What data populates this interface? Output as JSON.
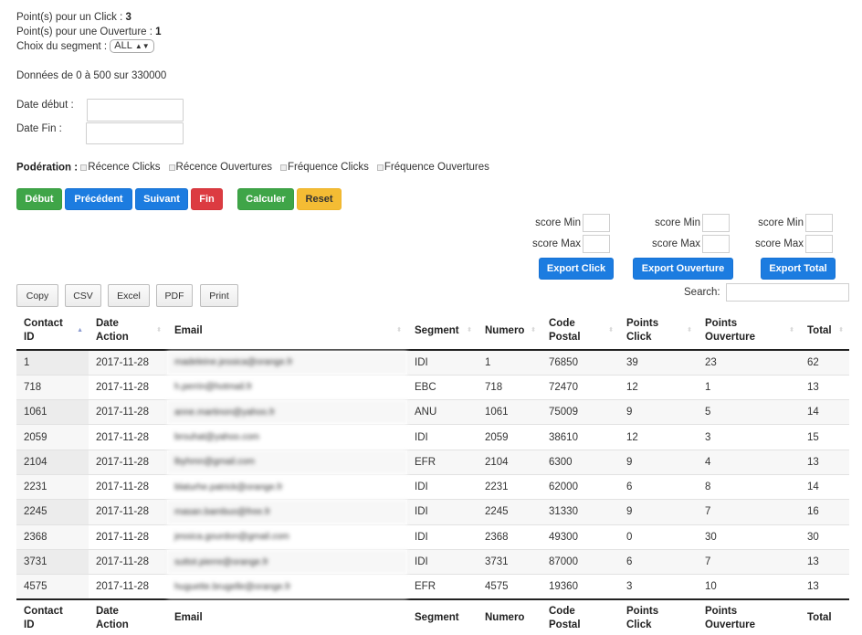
{
  "info": {
    "click_points_label": "Point(s) pour un Click : ",
    "click_points_value": "3",
    "open_points_label": "Point(s) pour une Ouverture : ",
    "open_points_value": "1",
    "segment_label": "Choix du segment : ",
    "segment_selected": "ALL",
    "data_range": "Données de 0 à 500 sur 330000"
  },
  "dates": {
    "start_label": "Date début :",
    "start_value": "",
    "end_label": "Date Fin :",
    "end_value": ""
  },
  "ponderation": {
    "label": "Podération : ",
    "options": [
      {
        "label": "Récence Clicks",
        "checked": false
      },
      {
        "label": "Récence Ouvertures",
        "checked": false
      },
      {
        "label": "Fréquence Clicks",
        "checked": false
      },
      {
        "label": "Fréquence Ouvertures",
        "checked": false
      }
    ]
  },
  "nav_buttons": {
    "debut": "Début",
    "precedent": "Précédent",
    "suivant": "Suivant",
    "fin": "Fin",
    "calculer": "Calculer",
    "reset": "Reset"
  },
  "colors": {
    "green": "#3fa548",
    "blue": "#1c7ce0",
    "red": "#dc3b41",
    "yellow": "#f4bc34"
  },
  "exports": [
    {
      "min_label": "score Min",
      "max_label": "score Max",
      "min_value": "",
      "max_value": "",
      "button": "Export Click"
    },
    {
      "min_label": "score Min",
      "max_label": "score Max",
      "min_value": "",
      "max_value": "",
      "button": "Export Ouverture"
    },
    {
      "min_label": "score Min",
      "max_label": "score Max",
      "min_value": "",
      "max_value": "",
      "button": "Export Total"
    }
  ],
  "table_buttons": [
    "Copy",
    "CSV",
    "Excel",
    "PDF",
    "Print"
  ],
  "search": {
    "label": "Search:",
    "value": ""
  },
  "table": {
    "columns": [
      {
        "line1": "Contact",
        "line2": "ID",
        "sort": "asc"
      },
      {
        "line1": "Date",
        "line2": "Action",
        "sort": "none"
      },
      {
        "line1": "Email",
        "line2": "",
        "sort": "none"
      },
      {
        "line1": "Segment",
        "line2": "",
        "sort": "none"
      },
      {
        "line1": "Numero",
        "line2": "",
        "sort": "none"
      },
      {
        "line1": "Code",
        "line2": "Postal",
        "sort": "none"
      },
      {
        "line1": "Points",
        "line2": "Click",
        "sort": "none"
      },
      {
        "line1": "Points",
        "line2": "Ouverture",
        "sort": "none"
      },
      {
        "line1": "Total",
        "line2": "",
        "sort": "none"
      }
    ],
    "rows": [
      {
        "contact_id": "1",
        "date": "2017-11-28",
        "email": "madeleine.jessica@orange.fr",
        "segment": "IDI",
        "numero": "1",
        "code_postal": "76850",
        "points_click": "39",
        "points_ouverture": "23",
        "total": "62"
      },
      {
        "contact_id": "718",
        "date": "2017-11-28",
        "email": "h.perrin@hotmail.fr",
        "segment": "EBC",
        "numero": "718",
        "code_postal": "72470",
        "points_click": "12",
        "points_ouverture": "1",
        "total": "13"
      },
      {
        "contact_id": "1061",
        "date": "2017-11-28",
        "email": "anne.martinon@yahoo.fr",
        "segment": "ANU",
        "numero": "1061",
        "code_postal": "75009",
        "points_click": "9",
        "points_ouverture": "5",
        "total": "14"
      },
      {
        "contact_id": "2059",
        "date": "2017-11-28",
        "email": "brouhat@yahoo.com",
        "segment": "IDI",
        "numero": "2059",
        "code_postal": "38610",
        "points_click": "12",
        "points_ouverture": "3",
        "total": "15"
      },
      {
        "contact_id": "2104",
        "date": "2017-11-28",
        "email": "lbyhmn@gmail.com",
        "segment": "EFR",
        "numero": "2104",
        "code_postal": "6300",
        "points_click": "9",
        "points_ouverture": "4",
        "total": "13"
      },
      {
        "contact_id": "2231",
        "date": "2017-11-28",
        "email": "blaturhe.patrick@orange.fr",
        "segment": "IDI",
        "numero": "2231",
        "code_postal": "62000",
        "points_click": "6",
        "points_ouverture": "8",
        "total": "14"
      },
      {
        "contact_id": "2245",
        "date": "2017-11-28",
        "email": "masan.bambuo@free.fr",
        "segment": "IDI",
        "numero": "2245",
        "code_postal": "31330",
        "points_click": "9",
        "points_ouverture": "7",
        "total": "16"
      },
      {
        "contact_id": "2368",
        "date": "2017-11-28",
        "email": "jessica.gourdon@gmail.com",
        "segment": "IDI",
        "numero": "2368",
        "code_postal": "49300",
        "points_click": "0",
        "points_ouverture": "30",
        "total": "30"
      },
      {
        "contact_id": "3731",
        "date": "2017-11-28",
        "email": "suttot.pierre@orange.fr",
        "segment": "IDI",
        "numero": "3731",
        "code_postal": "87000",
        "points_click": "6",
        "points_ouverture": "7",
        "total": "13"
      },
      {
        "contact_id": "4575",
        "date": "2017-11-28",
        "email": "huguette.brugelle@orange.fr",
        "segment": "EFR",
        "numero": "4575",
        "code_postal": "19360",
        "points_click": "3",
        "points_ouverture": "10",
        "total": "13"
      }
    ]
  }
}
